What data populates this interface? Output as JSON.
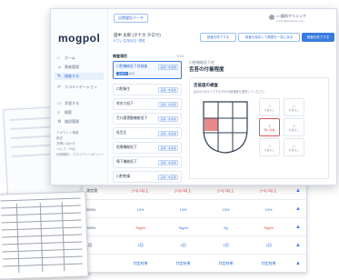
{
  "app": {
    "logo": "mogpol",
    "badge": "自費健診データ",
    "user_name": "○○歯科クリニック",
    "user_sub": "xxxxxx@example.com"
  },
  "sidebar": {
    "items": [
      {
        "label": "ホーム",
        "icon": "home-icon",
        "glyph": "⌂"
      },
      {
        "label": "患者管理",
        "icon": "users-icon",
        "glyph": "☺"
      },
      {
        "label": "検査する",
        "icon": "inspect-icon",
        "glyph": "✎",
        "active": true
      },
      {
        "label": "リコメンデーション",
        "icon": "pen-icon",
        "glyph": "✐"
      },
      {
        "label": "学習する",
        "icon": "book-icon",
        "glyph": "▭"
      },
      {
        "label": "検索",
        "icon": "search-icon",
        "glyph": "⌕"
      },
      {
        "label": "施設管理",
        "icon": "settings-icon",
        "glyph": "⚙"
      }
    ],
    "footer_links": [
      "アカウント情報",
      "設定",
      "お問い合わせ",
      "ヘルプ・FAQ",
      "利用規約・プライバシーポリシー"
    ]
  },
  "patient": {
    "name": "田中 太郎 (タナカ タロウ)",
    "info": "5 さい 生年月日 / 男性"
  },
  "header_buttons": [
    "検査を終了する",
    "検査を保存して履歴を一覧に戻る",
    "検査を終了する"
  ],
  "exam_list": {
    "title": "検査項目",
    "count": "7/10",
    "items": [
      {
        "label": "口腔機能低下症検査",
        "status": "実施 / 未実施",
        "pill": "実施済",
        "pill2": "未実施",
        "selected": true
      },
      {
        "label": "口腔衛生",
        "status": "実施 / 未実施"
      },
      {
        "label": "咬合力低下",
        "status": "実施 / 未実施"
      },
      {
        "label": "舌口唇運動機能低下",
        "status": "実施 / 未実施"
      },
      {
        "label": "低舌圧",
        "status": "実施 / 未実施"
      },
      {
        "label": "咀嚼機能低下",
        "status": "実施 / 未実施"
      },
      {
        "label": "嚥下機能低下",
        "status": "実施 / 未実施"
      },
      {
        "label": "口腔乾燥",
        "status": "実施 / 未実施"
      }
    ]
  },
  "right_panel": {
    "small_title": "口腔機能低下症",
    "title": "舌苔の付着程度",
    "box_title": "舌苔度の検査",
    "box_sub": "舌の9つのエリアそれぞれ付着程度を選択してください",
    "buttons": [
      {
        "num": "0",
        "cap": "付着なし"
      },
      {
        "num": "0",
        "cap": "付着なし"
      },
      {
        "num": "1",
        "cap": "薄い付着",
        "hot": true
      },
      {
        "num": "0",
        "cap": "付着なし"
      },
      {
        "num": "0",
        "cap": "付着なし"
      },
      {
        "num": "0",
        "cap": "付着なし"
      }
    ]
  },
  "sheet": {
    "rows": [
      {
        "label": "測定値",
        "values": [
          "[+1] 0以上",
          "[+1] 0以上",
          "[+1] 0以上",
          "[+1] 0以上"
        ],
        "red": true
      },
      {
        "label": "200%",
        "values": [
          "10%",
          "10%",
          "10%",
          "10%"
        ]
      },
      {
        "label": "200%",
        "values": [
          "7kg/m",
          "7kg/m",
          "9g",
          "7kg/m"
        ],
        "red": true
      },
      {
        "label": "1回",
        "values": [
          "1回",
          "1回",
          "1回",
          "1回"
        ]
      },
      {
        "label": "",
        "values": [
          "判定結果",
          "判定結果",
          "判定結果",
          "判定結果"
        ]
      }
    ]
  }
}
